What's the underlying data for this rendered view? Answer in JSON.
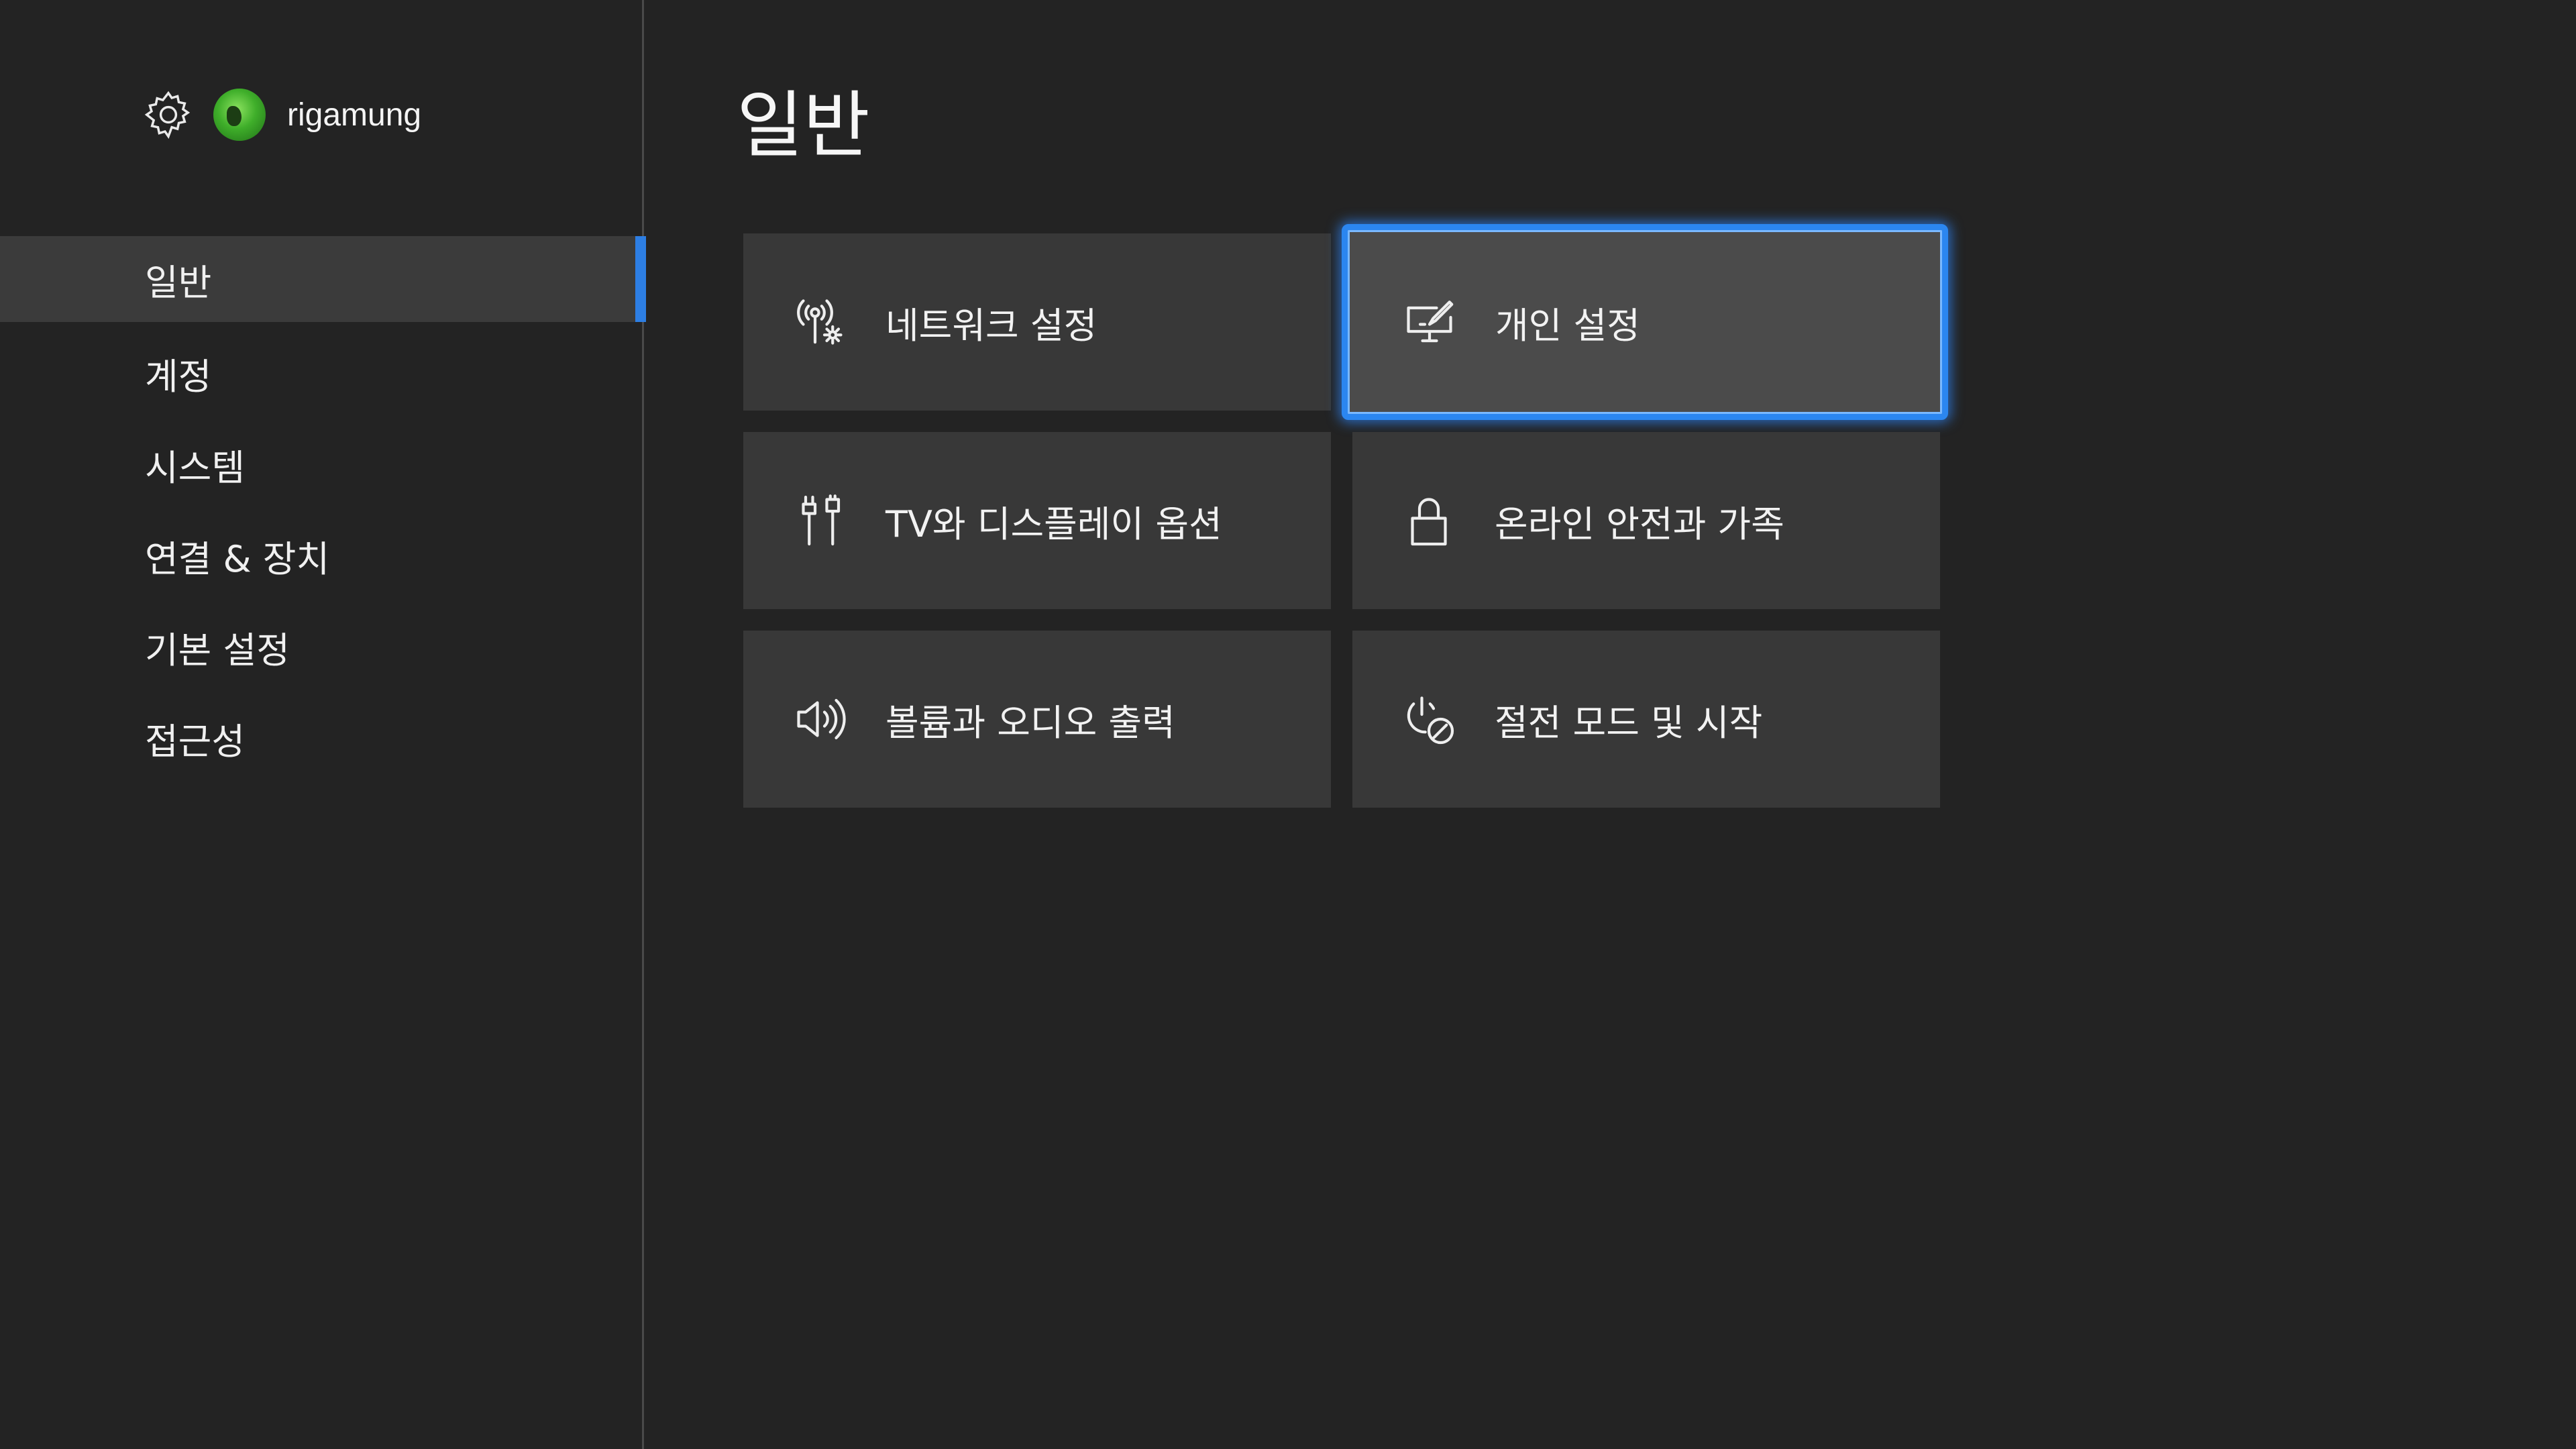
{
  "header": {
    "username": "rigamung",
    "icons": [
      "gear-icon",
      "avatar"
    ]
  },
  "sidebar": {
    "items": [
      {
        "label": "일반",
        "active": true
      },
      {
        "label": "계정",
        "active": false
      },
      {
        "label": "시스템",
        "active": false
      },
      {
        "label": "연결 & 장치",
        "active": false
      },
      {
        "label": "기본 설정",
        "active": false
      },
      {
        "label": "접근성",
        "active": false
      }
    ]
  },
  "main": {
    "title": "일반",
    "tiles": [
      {
        "label": "네트워크 설정",
        "icon": "network-settings-icon"
      },
      {
        "label": "개인 설정",
        "icon": "personalization-icon",
        "focused": true
      },
      {
        "label": "TV와 디스플레이 옵션",
        "icon": "tv-display-icon"
      },
      {
        "label": "온라인 안전과 가족",
        "icon": "lock-icon"
      },
      {
        "label": "볼륨과 오디오 출력",
        "icon": "speaker-volume-icon"
      },
      {
        "label": "절전 모드 및 시작",
        "icon": "power-leaf-icon"
      }
    ]
  },
  "colors": {
    "background": "#232323",
    "tile": "#383838",
    "tile_focused": "#4b4b4b",
    "accent": "#2b86f0",
    "text": "#f2f2f2"
  }
}
